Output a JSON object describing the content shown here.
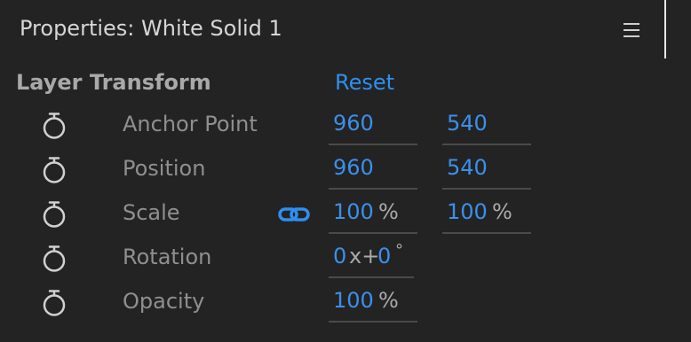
{
  "panel": {
    "title": "Properties: White Solid 1"
  },
  "section": {
    "title": "Layer Transform",
    "reset_label": "Reset"
  },
  "properties": {
    "anchor_point": {
      "label": "Anchor Point",
      "x": "960",
      "y": "540"
    },
    "position": {
      "label": "Position",
      "x": "960",
      "y": "540"
    },
    "scale": {
      "label": "Scale",
      "x": "100",
      "y": "100",
      "unit": "%"
    },
    "rotation": {
      "label": "Rotation",
      "revolutions": "0",
      "separator": "x+",
      "degrees": "0",
      "unit": "°"
    },
    "opacity": {
      "label": "Opacity",
      "value": "100",
      "unit": "%"
    }
  },
  "colors": {
    "accent": "#2e8ff0",
    "background": "#232323",
    "label": "#8f8f8f"
  },
  "icons": {
    "stopwatch": "stopwatch-icon",
    "link": "link-icon",
    "menu": "hamburger-menu-icon"
  }
}
